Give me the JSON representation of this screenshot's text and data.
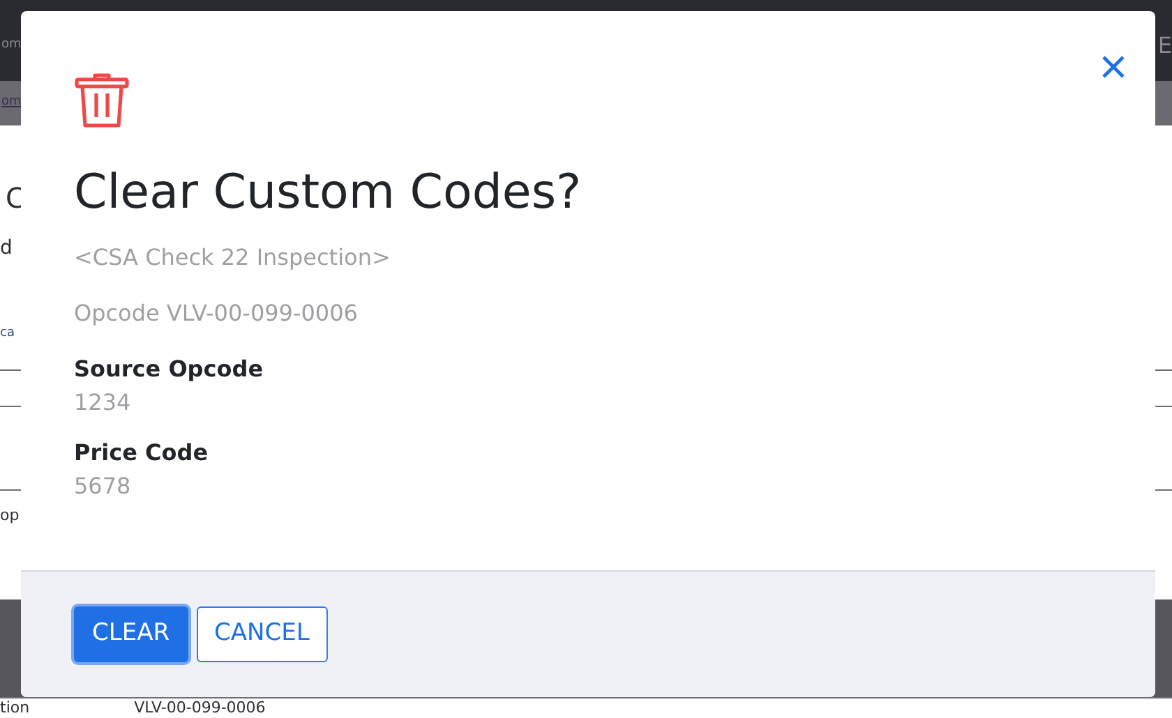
{
  "background": {
    "navbar_left": "om",
    "navbar_right": "E",
    "breadcrumb": "om",
    "heading": "C",
    "subtitle": "d",
    "tab": "ca",
    "label": "op",
    "row_cells": [
      "tion",
      "VLV-00-099-0006"
    ]
  },
  "dialog": {
    "title": "Clear Custom Codes?",
    "subtitle": "<CSA Check 22 Inspection>",
    "opcode": "Opcode VLV-00-099-0006",
    "fields": [
      {
        "label": "Source Opcode",
        "value": "1234"
      },
      {
        "label": "Price Code",
        "value": "5678"
      }
    ],
    "buttons": [
      {
        "label": "CLEAR",
        "kind": "primary"
      },
      {
        "label": "CANCEL",
        "kind": "outline"
      }
    ]
  }
}
